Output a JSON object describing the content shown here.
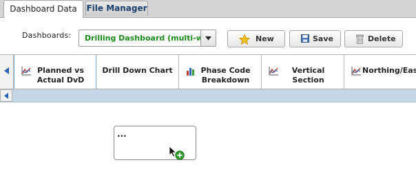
{
  "tabs": [
    {
      "label": "Dashboard Data",
      "active": true
    },
    {
      "label": "File Manager",
      "active": false
    }
  ],
  "toolbar": {
    "dashboards_label": "Dashboards:",
    "dashboard_value": "Drilling Dashboard (multi-we",
    "new_label": "New",
    "save_label": "Save",
    "delete_label": "Delete"
  },
  "chart_tabs": [
    {
      "label": "Planned vs Actual DvD",
      "icon": "line-chart-icon"
    },
    {
      "label": "Drill Down Chart",
      "icon": ""
    },
    {
      "label": "Phase Code Breakdown",
      "icon": "bar-chart-icon"
    },
    {
      "label": "Vertical Section",
      "icon": "line-chart-icon"
    },
    {
      "label": "Northing/Easting",
      "icon": "line-chart-icon"
    }
  ],
  "widget": {
    "text": "..."
  },
  "colors": {
    "accent_green": "#1a8a1a",
    "strip_blue": "#c5d6e6",
    "tab_text_blue": "#1c3f6e"
  }
}
